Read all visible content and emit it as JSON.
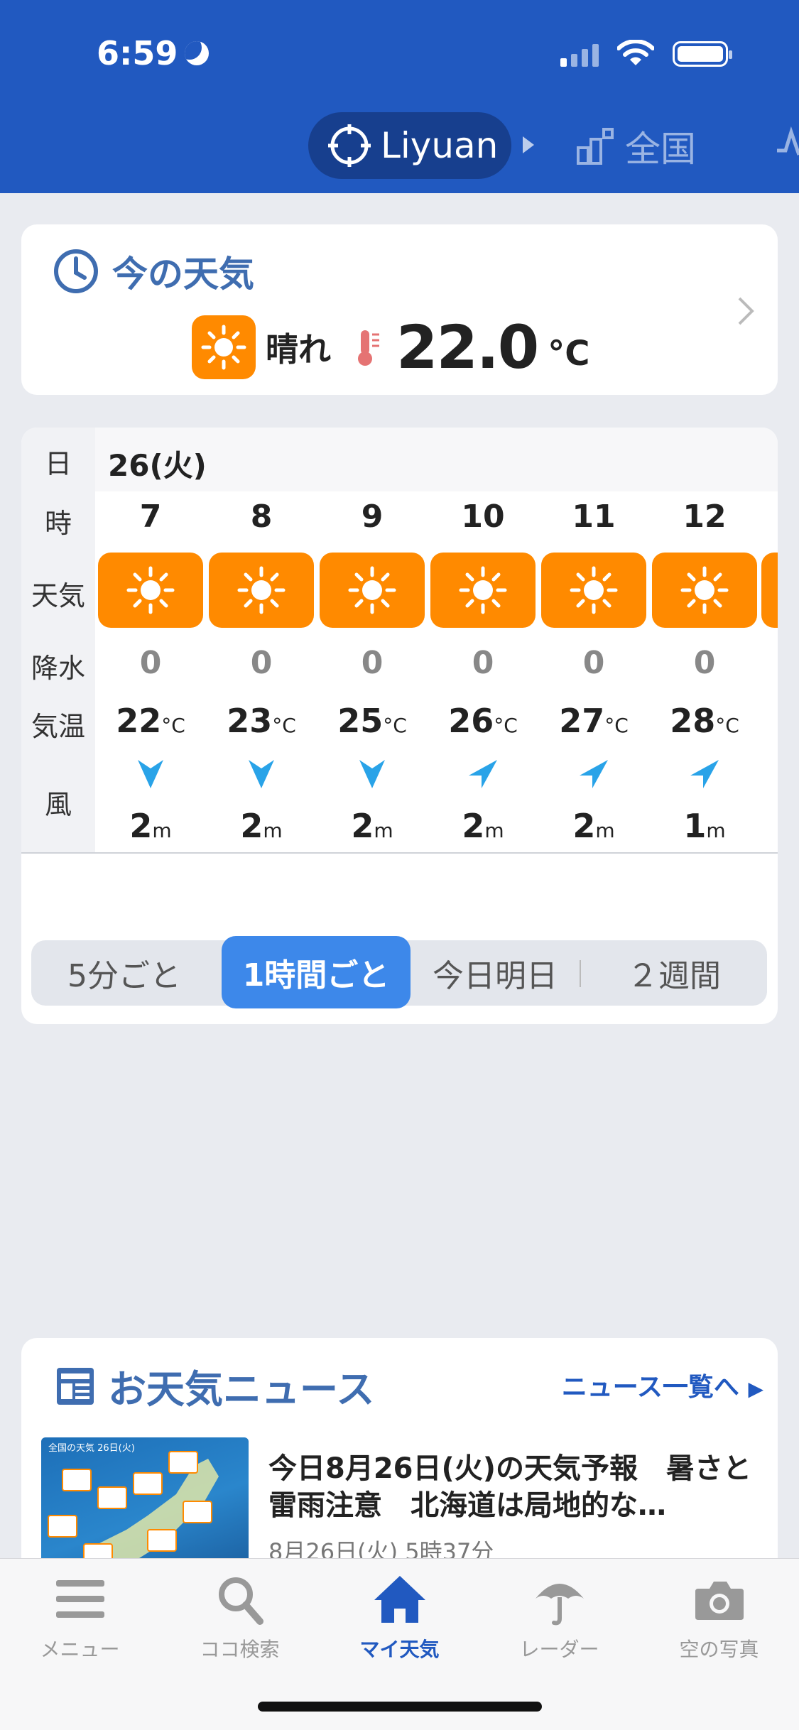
{
  "status": {
    "time": "6:59"
  },
  "header": {
    "location": "Liyuan",
    "nation_tab": "全国"
  },
  "now": {
    "title": "今の天気",
    "weather": "晴れ",
    "temperature": "22.0",
    "unit": "°C"
  },
  "hourly": {
    "row_labels": {
      "date": "日",
      "hour": "時",
      "weather": "天気",
      "rain": "降水",
      "temp": "気温",
      "wind": "風"
    },
    "date": "26(火)",
    "hours": [
      {
        "hour": "7",
        "weather": "sun-icon",
        "rain": "0",
        "temp": "22",
        "temp_unit": "°C",
        "wind": "2",
        "wind_unit": "m"
      },
      {
        "hour": "8",
        "weather": "sun-icon",
        "rain": "0",
        "temp": "23",
        "temp_unit": "°C",
        "wind": "2",
        "wind_unit": "m"
      },
      {
        "hour": "9",
        "weather": "sun-icon",
        "rain": "0",
        "temp": "25",
        "temp_unit": "°C",
        "wind": "2",
        "wind_unit": "m"
      },
      {
        "hour": "10",
        "weather": "sun-icon",
        "rain": "0",
        "temp": "26",
        "temp_unit": "°C",
        "wind": "2",
        "wind_unit": "m"
      },
      {
        "hour": "11",
        "weather": "sun-icon",
        "rain": "0",
        "temp": "27",
        "temp_unit": "°C",
        "wind": "2",
        "wind_unit": "m"
      },
      {
        "hour": "12",
        "weather": "sun-icon",
        "rain": "0",
        "temp": "28",
        "temp_unit": "°C",
        "wind": "1",
        "wind_unit": "m"
      }
    ],
    "segments": [
      "5分ごと",
      "1時間ごと",
      "今日明日",
      "２週間"
    ],
    "active_segment": "1時間ごと"
  },
  "news": {
    "title": "お天気ニュース",
    "link": "ニュース一覧へ",
    "thumb_title": "全国の天気 26日(火)",
    "headline": "今日8月26日(火)の天気予報　暑さと雷雨注意　北海道は局地的な…",
    "meta": "8月26日(火) 5時37分"
  },
  "tabbar": {
    "items": [
      {
        "label": "メニュー",
        "icon": "menu-icon"
      },
      {
        "label": "ココ検索",
        "icon": "search-icon"
      },
      {
        "label": "マイ天気",
        "icon": "home-icon"
      },
      {
        "label": "レーダー",
        "icon": "umbrella-icon"
      },
      {
        "label": "空の写真",
        "icon": "camera-icon"
      }
    ],
    "active": "マイ天気"
  },
  "colors": {
    "header": "#2159c0",
    "accent_orange": "#ff8a00",
    "active_blue": "#3d88ea",
    "wind_arrow": "#29a3e8"
  }
}
